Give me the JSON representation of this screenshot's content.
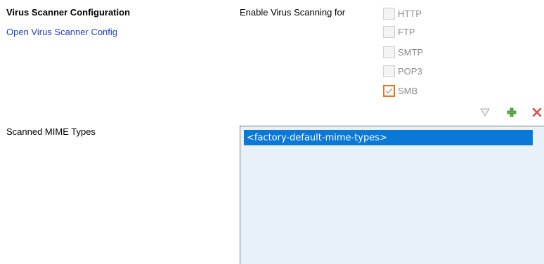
{
  "virus_scanner": {
    "title": "Virus Scanner Configuration",
    "open_config_link": "Open Virus Scanner Config"
  },
  "scanning": {
    "label": "Enable Virus Scanning for",
    "protocols": [
      {
        "label": "HTTP",
        "checked": false
      },
      {
        "label": "FTP",
        "checked": false
      },
      {
        "label": "SMTP",
        "checked": false
      },
      {
        "label": "POP3",
        "checked": false
      },
      {
        "label": "SMB",
        "checked": true
      }
    ]
  },
  "mime": {
    "label": "Scanned MIME Types",
    "items": [
      "<factory-default-mime-types>"
    ],
    "toolbar": [
      "filter-icon",
      "add-icon",
      "remove-icon"
    ]
  },
  "colors": {
    "link": "#1f3fc9",
    "selection": "#0a78d7",
    "checked_border": "#e8761b",
    "list_background": "#e8f0f8"
  }
}
